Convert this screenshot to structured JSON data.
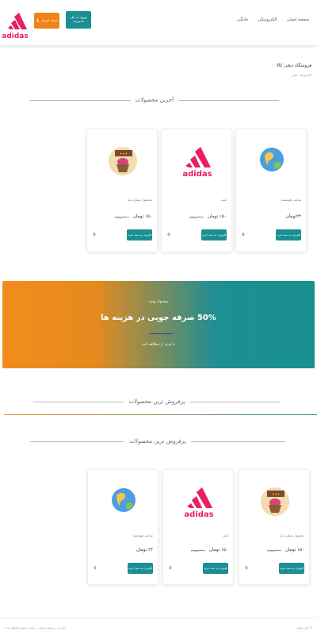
{
  "header": {
    "logo_text": "adidas",
    "cart_label": "سبد خرید",
    "cart_count": "۱",
    "panel_label": "ورود به پنل مدیریت",
    "nav": [
      "صفحه اصلی",
      "الکترونیکی",
      "خانگی"
    ]
  },
  "store": {
    "title": "فروشگاه دیجی کالا",
    "subtitle": "الکترونیک، لباس"
  },
  "sections": {
    "latest": "آخرین محصولات",
    "best1": "پرفروش ترین محصولات",
    "best2": "پرفروش ترین محصولات"
  },
  "products_latest": [
    {
      "name": "ساعت هوشمند",
      "price": "۳۴تومان",
      "old": "",
      "image": "globe",
      "add": "افزودن به سبد خرید"
    },
    {
      "name": "کیف",
      "price": "۱۵۰ تومان",
      "old": "۲۰۰ تومان",
      "image": "adidas",
      "add": "افزودن به سبد خرید"
    },
    {
      "name": "محصول شماره یک",
      "price": "۱۵۰ تومان",
      "old": "۲۰۰ تومان",
      "image": "cake",
      "add": "افزودن به سبد خرید"
    }
  ],
  "banner": {
    "subtitle": "پیشنهاد ویژه",
    "title": "50% صرفه جویی در هزینه ها",
    "cta": "با خرید از مطالعه کنید"
  },
  "products_best": [
    {
      "name": "محصول شماره یک",
      "price": "۱۵۰ تومان",
      "old": "۲۰۰ تومان",
      "image": "cake",
      "add": "افزودن به سبد خرید"
    },
    {
      "name": "کیف",
      "price": "۱۵۰ تومان",
      "old": "۲۰۰ تومان",
      "image": "adidas",
      "add": "افزودن به سبد خرید"
    },
    {
      "name": "ساعت هوشمند",
      "price": "۳۴ تومان",
      "old": "",
      "image": "globe",
      "add": "افزودن به سبد خرید"
    }
  ],
  "footer": {
    "right": "© کلیه حقوق ...",
    "left": "طراحی و توسعه توسط ... تمامی حقوق محفوظ است"
  },
  "colors": {
    "accent": "#1a8f94",
    "orange": "#f0841a",
    "brand_red": "#e91e63"
  }
}
